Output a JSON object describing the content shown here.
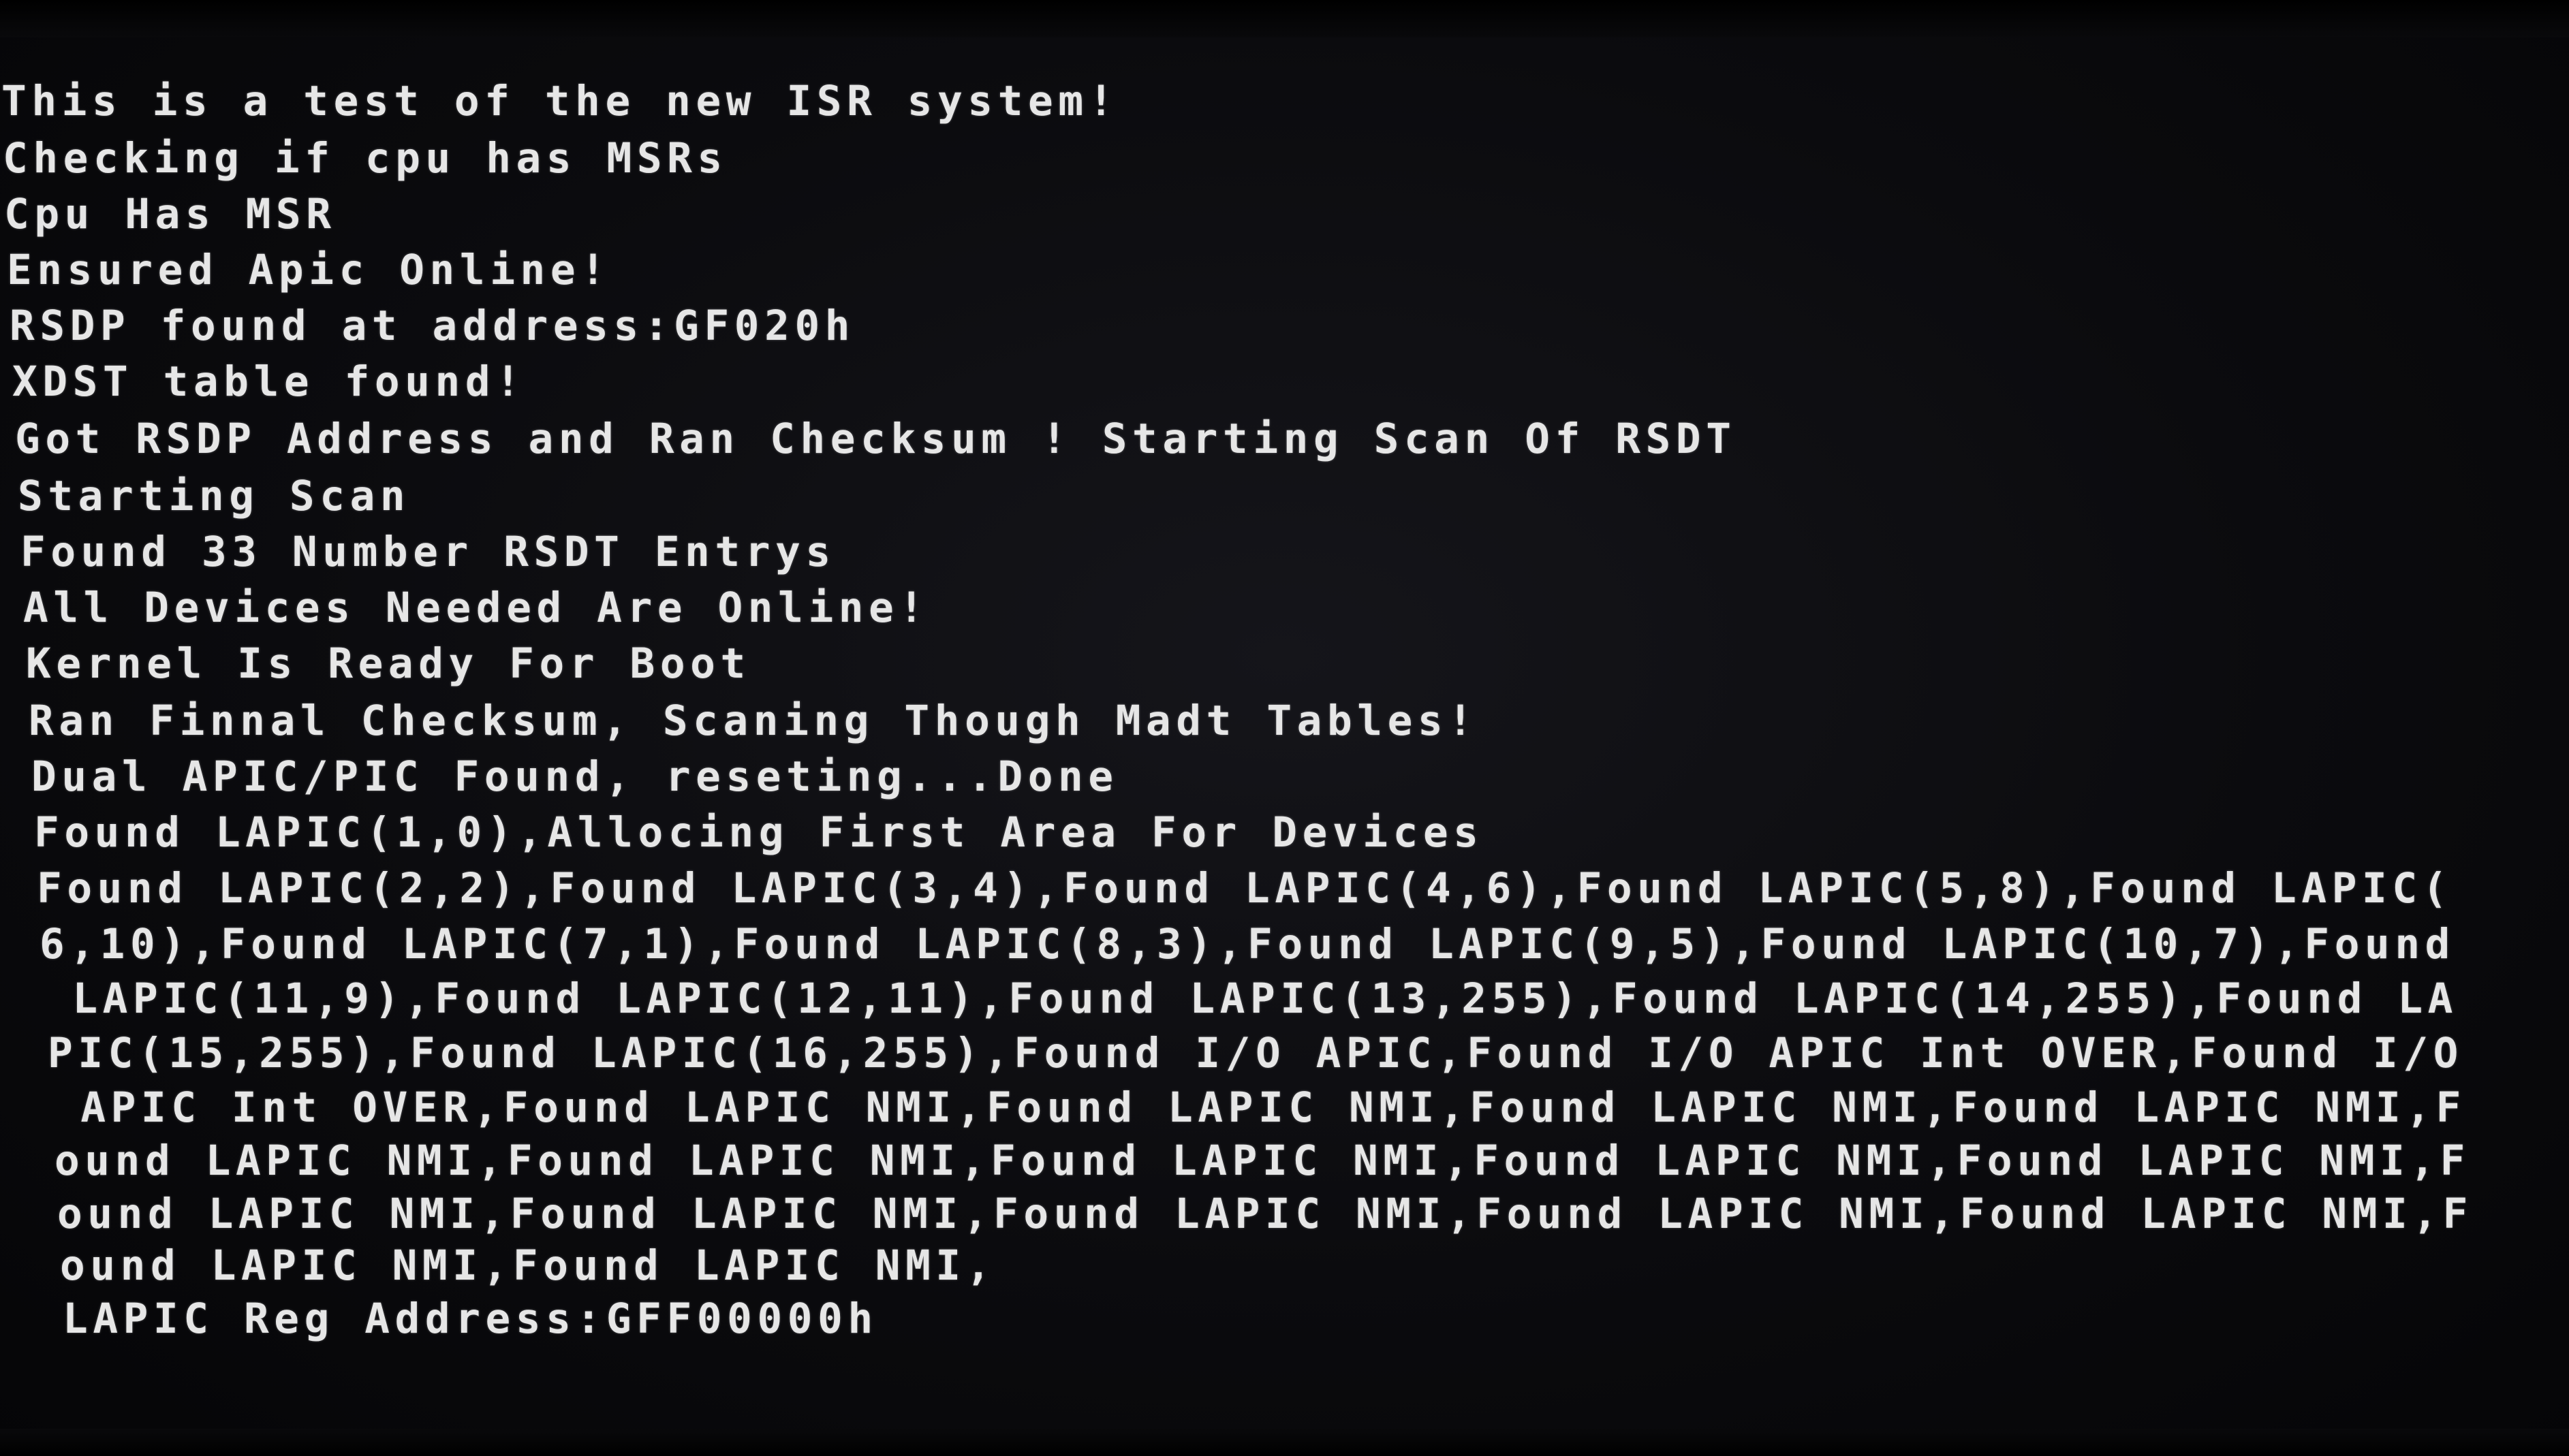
{
  "console": {
    "lines": [
      "This is a test of the new ISR system!",
      "Checking if cpu has MSRs",
      "Cpu Has MSR",
      "Ensured Apic Online!",
      "RSDP found at address:GF020h",
      "XDST table found!",
      "Got RSDP Address and Ran Checksum ! Starting Scan Of RSDT",
      "Starting Scan",
      "Found 33 Number RSDT Entrys",
      "All Devices Needed Are Online!",
      "Kernel Is Ready For Boot",
      "Ran Finnal Checksum, Scaning Though Madt Tables!",
      "Dual APIC/PIC Found, reseting...Done",
      "Found LAPIC(1,0),Allocing First Area For Devices",
      "Found LAPIC(2,2),Found LAPIC(3,4),Found LAPIC(4,6),Found LAPIC(5,8),Found LAPIC(",
      "6,10),Found LAPIC(7,1),Found LAPIC(8,3),Found LAPIC(9,5),Found LAPIC(10,7),Found",
      " LAPIC(11,9),Found LAPIC(12,11),Found LAPIC(13,255),Found LAPIC(14,255),Found LA",
      "PIC(15,255),Found LAPIC(16,255),Found I/O APIC,Found I/O APIC Int OVER,Found I/O",
      " APIC Int OVER,Found LAPIC NMI,Found LAPIC NMI,Found LAPIC NMI,Found LAPIC NMI,F",
      "ound LAPIC NMI,Found LAPIC NMI,Found LAPIC NMI,Found LAPIC NMI,Found LAPIC NMI,F",
      "ound LAPIC NMI,Found LAPIC NMI,Found LAPIC NMI,Found LAPIC NMI,Found LAPIC NMI,F",
      "ound LAPIC NMI,Found LAPIC NMI,",
      "LAPIC Reg Address:GFF00000h"
    ]
  },
  "colors": {
    "background": "#0a0a0c",
    "text": "#e6e6e6"
  }
}
